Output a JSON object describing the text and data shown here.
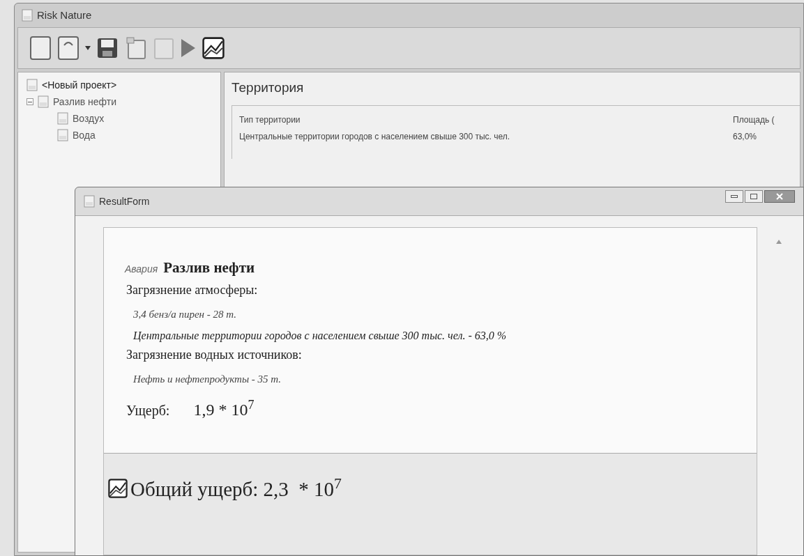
{
  "main_window": {
    "title": "Risk Nature"
  },
  "tree": [
    {
      "label": "<Новый проект>",
      "children": [
        {
          "label": "Разлив нефти",
          "expanded": true,
          "children": [
            {
              "label": "Воздух"
            },
            {
              "label": "Вода"
            }
          ]
        }
      ]
    }
  ],
  "territory": {
    "title": "Территория",
    "columns": [
      "Тип территории",
      "Площадь ("
    ],
    "rows": [
      [
        "Центральные территории городов с населением свыше 300 тыс. чел.",
        "63,0%"
      ]
    ]
  },
  "result_form": {
    "title": "ResultForm",
    "accident_label": "Авария",
    "accident_name": "Разлив нефти",
    "sections": [
      {
        "heading": "Загрязнение атмосферы:",
        "items": [
          "3,4 бенз/а пирен - 28 т.",
          "Центральные территории городов с населением свыше 300 тыс. чел. - 63,0 %"
        ]
      },
      {
        "heading": "Загрязнение водных источников:",
        "items": [
          "Нефть и нефтепродукты - 35 т."
        ]
      }
    ],
    "damage_label": "Ущерб:",
    "damage_value": "1,9 * 10$^{7}$",
    "total": "Общий ущерб: 2,3  * 10$^{7}$"
  }
}
